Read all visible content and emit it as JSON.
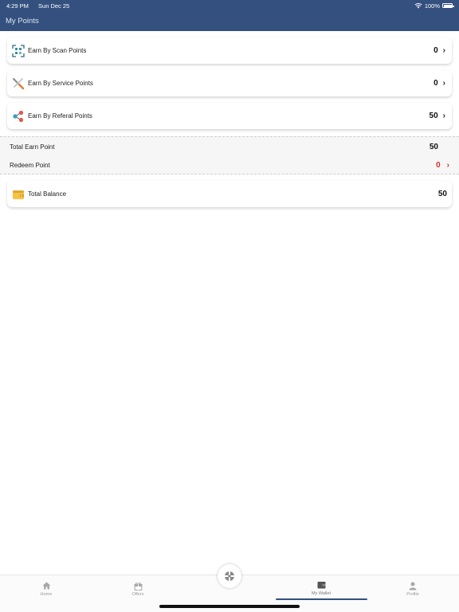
{
  "status": {
    "time": "4:29 PM",
    "date": "Sun Dec 25",
    "battery": "100%"
  },
  "header": {
    "title": "My Points"
  },
  "cards": [
    {
      "label": "Earn By Scan Points",
      "value": "0",
      "icon": "scan-icon"
    },
    {
      "label": "Earn By Service Points",
      "value": "0",
      "icon": "tools-icon"
    },
    {
      "label": "Earn By Referal Points",
      "value": "50",
      "icon": "share-icon"
    }
  ],
  "summary": {
    "total_earn_label": "Total Earn Point",
    "total_earn_value": "50",
    "redeem_label": "Redeem Point",
    "redeem_value": "0"
  },
  "balance": {
    "label": "Total Balance",
    "value": "50",
    "icon": "wallet-icon"
  },
  "tabs": [
    {
      "label": "Home",
      "icon": "home-icon"
    },
    {
      "label": "Offers",
      "icon": "gift-icon"
    },
    {
      "label": "My Wallet",
      "icon": "wallet-icon"
    },
    {
      "label": "Profile",
      "icon": "user-icon"
    }
  ],
  "colors": {
    "header": "#34507f",
    "redeem": "#d33333"
  }
}
